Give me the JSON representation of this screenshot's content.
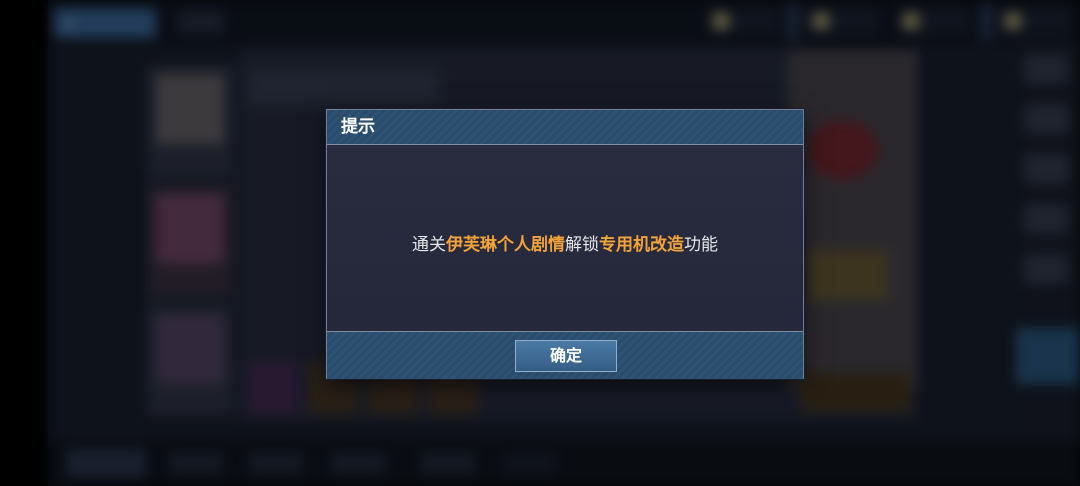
{
  "dialog": {
    "title": "提示",
    "message": {
      "prefix": "通关",
      "highlight1": "伊芙琳个人剧情",
      "middle": "解锁",
      "highlight2": "专用机改造",
      "suffix": "功能"
    },
    "confirm_label": "确定"
  },
  "colors": {
    "highlight": "#f3a33a",
    "header_bg": "#2e5273",
    "body_bg": "#262a3c",
    "button_bg": "#4a7aa5"
  },
  "background": {
    "back_icon": "chevron-left-icon"
  }
}
